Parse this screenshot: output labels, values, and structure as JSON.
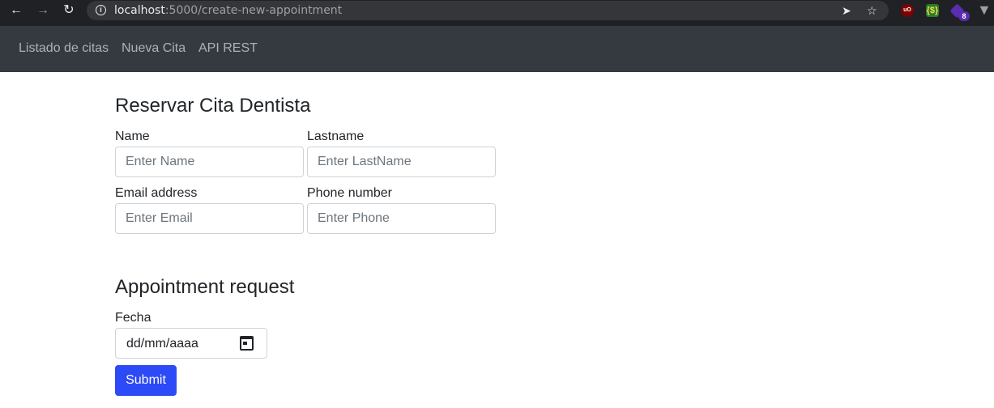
{
  "browser": {
    "url_host": "localhost",
    "url_path": ":5000/create-new-appointment",
    "extension_badge": "8",
    "ublock_label": "uO",
    "json_label": "{$}"
  },
  "navbar": {
    "items": [
      {
        "label": "Listado de citas"
      },
      {
        "label": "Nueva Cita"
      },
      {
        "label": "API REST"
      }
    ]
  },
  "form": {
    "title": "Reservar Cita Dentista",
    "name": {
      "label": "Name",
      "placeholder": "Enter Name",
      "value": ""
    },
    "lastname": {
      "label": "Lastname",
      "placeholder": "Enter LastName",
      "value": ""
    },
    "email": {
      "label": "Email address",
      "placeholder": "Enter Email",
      "value": ""
    },
    "phone": {
      "label": "Phone number",
      "placeholder": "Enter Phone",
      "value": ""
    }
  },
  "appointment": {
    "title": "Appointment request",
    "date_label": "Fecha",
    "date_value": "dd/mm/aaaa",
    "submit_label": "Submit"
  }
}
